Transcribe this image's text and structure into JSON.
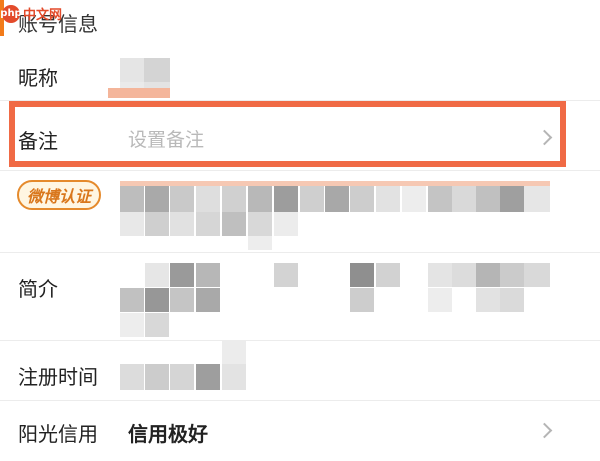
{
  "watermark": {
    "logo": "php",
    "text": "中文网"
  },
  "section": {
    "title": "账号信息"
  },
  "rows": {
    "nickname": {
      "label": "昵称"
    },
    "remark": {
      "label": "备注",
      "placeholder": "设置备注"
    },
    "verify": {
      "badge": "微博认证"
    },
    "bio": {
      "label": "简介"
    },
    "register": {
      "label": "注册时间"
    },
    "credit": {
      "label": "阳光信用",
      "value": "信用极好"
    }
  },
  "colors": {
    "accent": "#f27b1a",
    "highlight": "#f06a45",
    "badge": "#e58a2c"
  },
  "icons": {
    "chevron": "chevron-right-icon"
  }
}
